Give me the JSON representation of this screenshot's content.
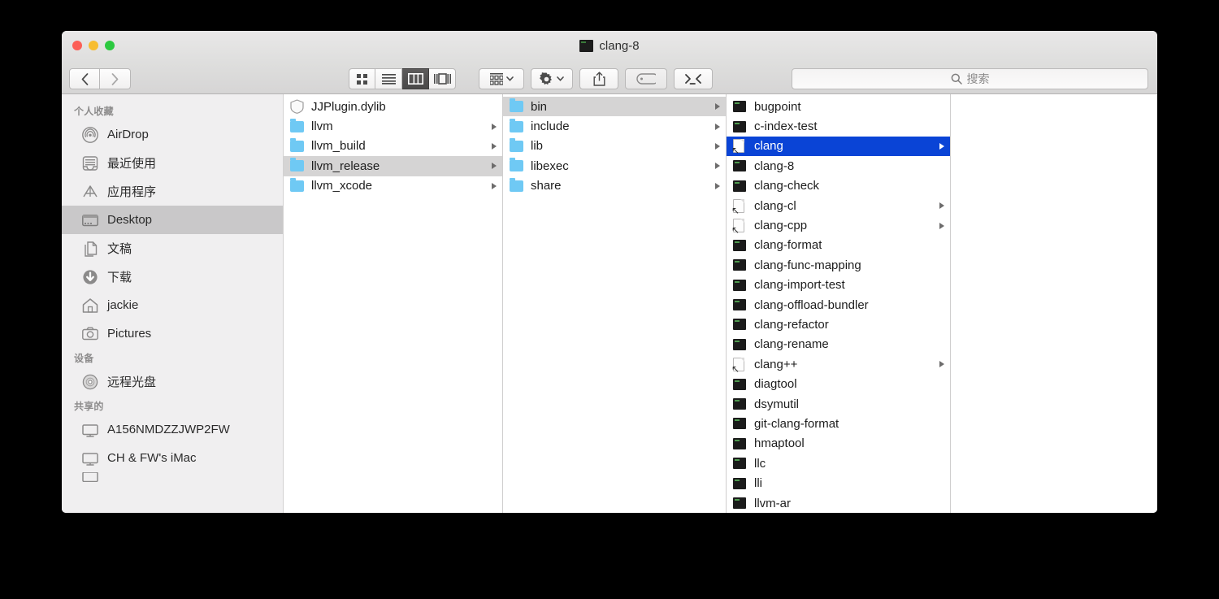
{
  "window": {
    "title": "clang-8",
    "title_icon": "executable-icon",
    "traffic_lights": [
      "close",
      "minimize",
      "zoom"
    ]
  },
  "toolbar": {
    "back_label": "‹",
    "forward_label": "›",
    "view_modes": [
      {
        "name": "icon-view",
        "active": false
      },
      {
        "name": "list-view",
        "active": false
      },
      {
        "name": "column-view",
        "active": true
      },
      {
        "name": "gallery-view",
        "active": false
      }
    ],
    "buttons": [
      {
        "name": "arrange-button",
        "icon": "grid-icon",
        "has_chevron": true
      },
      {
        "name": "action-button",
        "icon": "gear-icon",
        "has_chevron": true
      },
      {
        "name": "share-button",
        "icon": "share-icon",
        "has_chevron": false
      },
      {
        "name": "tag-button",
        "icon": "tag-icon",
        "has_chevron": false
      },
      {
        "name": "terminal-button",
        "icon": "terminal-icon",
        "has_chevron": false
      }
    ]
  },
  "search": {
    "placeholder": "搜索",
    "value": "",
    "icon": "search-icon"
  },
  "sidebar": {
    "sections": [
      {
        "header": "个人收藏",
        "items": [
          {
            "label": "AirDrop",
            "icon": "airdrop-icon",
            "selected": false
          },
          {
            "label": "最近使用",
            "icon": "recents-icon",
            "selected": false
          },
          {
            "label": "应用程序",
            "icon": "applications-icon",
            "selected": false
          },
          {
            "label": "Desktop",
            "icon": "desktop-icon",
            "selected": true
          },
          {
            "label": "文稿",
            "icon": "documents-icon",
            "selected": false
          },
          {
            "label": "下载",
            "icon": "downloads-icon",
            "selected": false
          },
          {
            "label": "jackie",
            "icon": "home-icon",
            "selected": false
          },
          {
            "label": "Pictures",
            "icon": "pictures-icon",
            "selected": false
          }
        ]
      },
      {
        "header": "设备",
        "items": [
          {
            "label": "远程光盘",
            "icon": "disc-icon",
            "selected": false
          }
        ]
      },
      {
        "header": "共享的",
        "items": [
          {
            "label": "A156NMDZZJWP2FW",
            "icon": "computer-icon",
            "selected": false
          },
          {
            "label": "CH & FW's iMac",
            "icon": "computer-icon",
            "selected": false
          },
          {
            "label": "",
            "icon": "computer-icon",
            "selected": false
          }
        ]
      }
    ]
  },
  "columns": [
    {
      "name": "column-1",
      "items": [
        {
          "label": "JJPlugin.dylib",
          "icon": "dylib-icon",
          "arrow": false,
          "state": "none"
        },
        {
          "label": "llvm",
          "icon": "folder-icon",
          "arrow": true,
          "state": "none"
        },
        {
          "label": "llvm_build",
          "icon": "folder-icon",
          "arrow": true,
          "state": "none"
        },
        {
          "label": "llvm_release",
          "icon": "folder-icon",
          "arrow": true,
          "state": "selected-inactive"
        },
        {
          "label": "llvm_xcode",
          "icon": "folder-icon",
          "arrow": true,
          "state": "none"
        }
      ]
    },
    {
      "name": "column-2",
      "items": [
        {
          "label": "bin",
          "icon": "folder-icon",
          "arrow": true,
          "state": "selected-inactive"
        },
        {
          "label": "include",
          "icon": "folder-icon",
          "arrow": true,
          "state": "none"
        },
        {
          "label": "lib",
          "icon": "folder-icon",
          "arrow": true,
          "state": "none"
        },
        {
          "label": "libexec",
          "icon": "folder-icon",
          "arrow": true,
          "state": "none"
        },
        {
          "label": "share",
          "icon": "folder-icon",
          "arrow": true,
          "state": "none"
        }
      ]
    },
    {
      "name": "column-3",
      "items": [
        {
          "label": "bugpoint",
          "icon": "executable-icon",
          "arrow": false,
          "state": "none"
        },
        {
          "label": "c-index-test",
          "icon": "executable-icon",
          "arrow": false,
          "state": "none"
        },
        {
          "label": "clang",
          "icon": "alias-icon",
          "arrow": true,
          "state": "selected-active"
        },
        {
          "label": "clang-8",
          "icon": "executable-icon",
          "arrow": false,
          "state": "none"
        },
        {
          "label": "clang-check",
          "icon": "executable-icon",
          "arrow": false,
          "state": "none"
        },
        {
          "label": "clang-cl",
          "icon": "alias-icon",
          "arrow": true,
          "state": "none"
        },
        {
          "label": "clang-cpp",
          "icon": "alias-icon",
          "arrow": true,
          "state": "none"
        },
        {
          "label": "clang-format",
          "icon": "executable-icon",
          "arrow": false,
          "state": "none"
        },
        {
          "label": "clang-func-mapping",
          "icon": "executable-icon",
          "arrow": false,
          "state": "none"
        },
        {
          "label": "clang-import-test",
          "icon": "executable-icon",
          "arrow": false,
          "state": "none"
        },
        {
          "label": "clang-offload-bundler",
          "icon": "executable-icon",
          "arrow": false,
          "state": "none"
        },
        {
          "label": "clang-refactor",
          "icon": "executable-icon",
          "arrow": false,
          "state": "none"
        },
        {
          "label": "clang-rename",
          "icon": "executable-icon",
          "arrow": false,
          "state": "none"
        },
        {
          "label": "clang++",
          "icon": "alias-icon",
          "arrow": true,
          "state": "none"
        },
        {
          "label": "diagtool",
          "icon": "executable-icon",
          "arrow": false,
          "state": "none"
        },
        {
          "label": "dsymutil",
          "icon": "executable-icon",
          "arrow": false,
          "state": "none"
        },
        {
          "label": "git-clang-format",
          "icon": "executable-icon",
          "arrow": false,
          "state": "none"
        },
        {
          "label": "hmaptool",
          "icon": "executable-icon",
          "arrow": false,
          "state": "none"
        },
        {
          "label": "llc",
          "icon": "executable-icon",
          "arrow": false,
          "state": "none"
        },
        {
          "label": "lli",
          "icon": "executable-icon",
          "arrow": false,
          "state": "none"
        },
        {
          "label": "llvm-ar",
          "icon": "executable-icon",
          "arrow": false,
          "state": "none"
        }
      ]
    },
    {
      "name": "column-4",
      "items": []
    }
  ],
  "colors": {
    "selection_active": "#0a44d6",
    "selection_inactive": "#d5d4d4",
    "sidebar_bg": "#f0eff0",
    "folder_blue": "#6fc9f4",
    "titlebar": "#dededd"
  }
}
